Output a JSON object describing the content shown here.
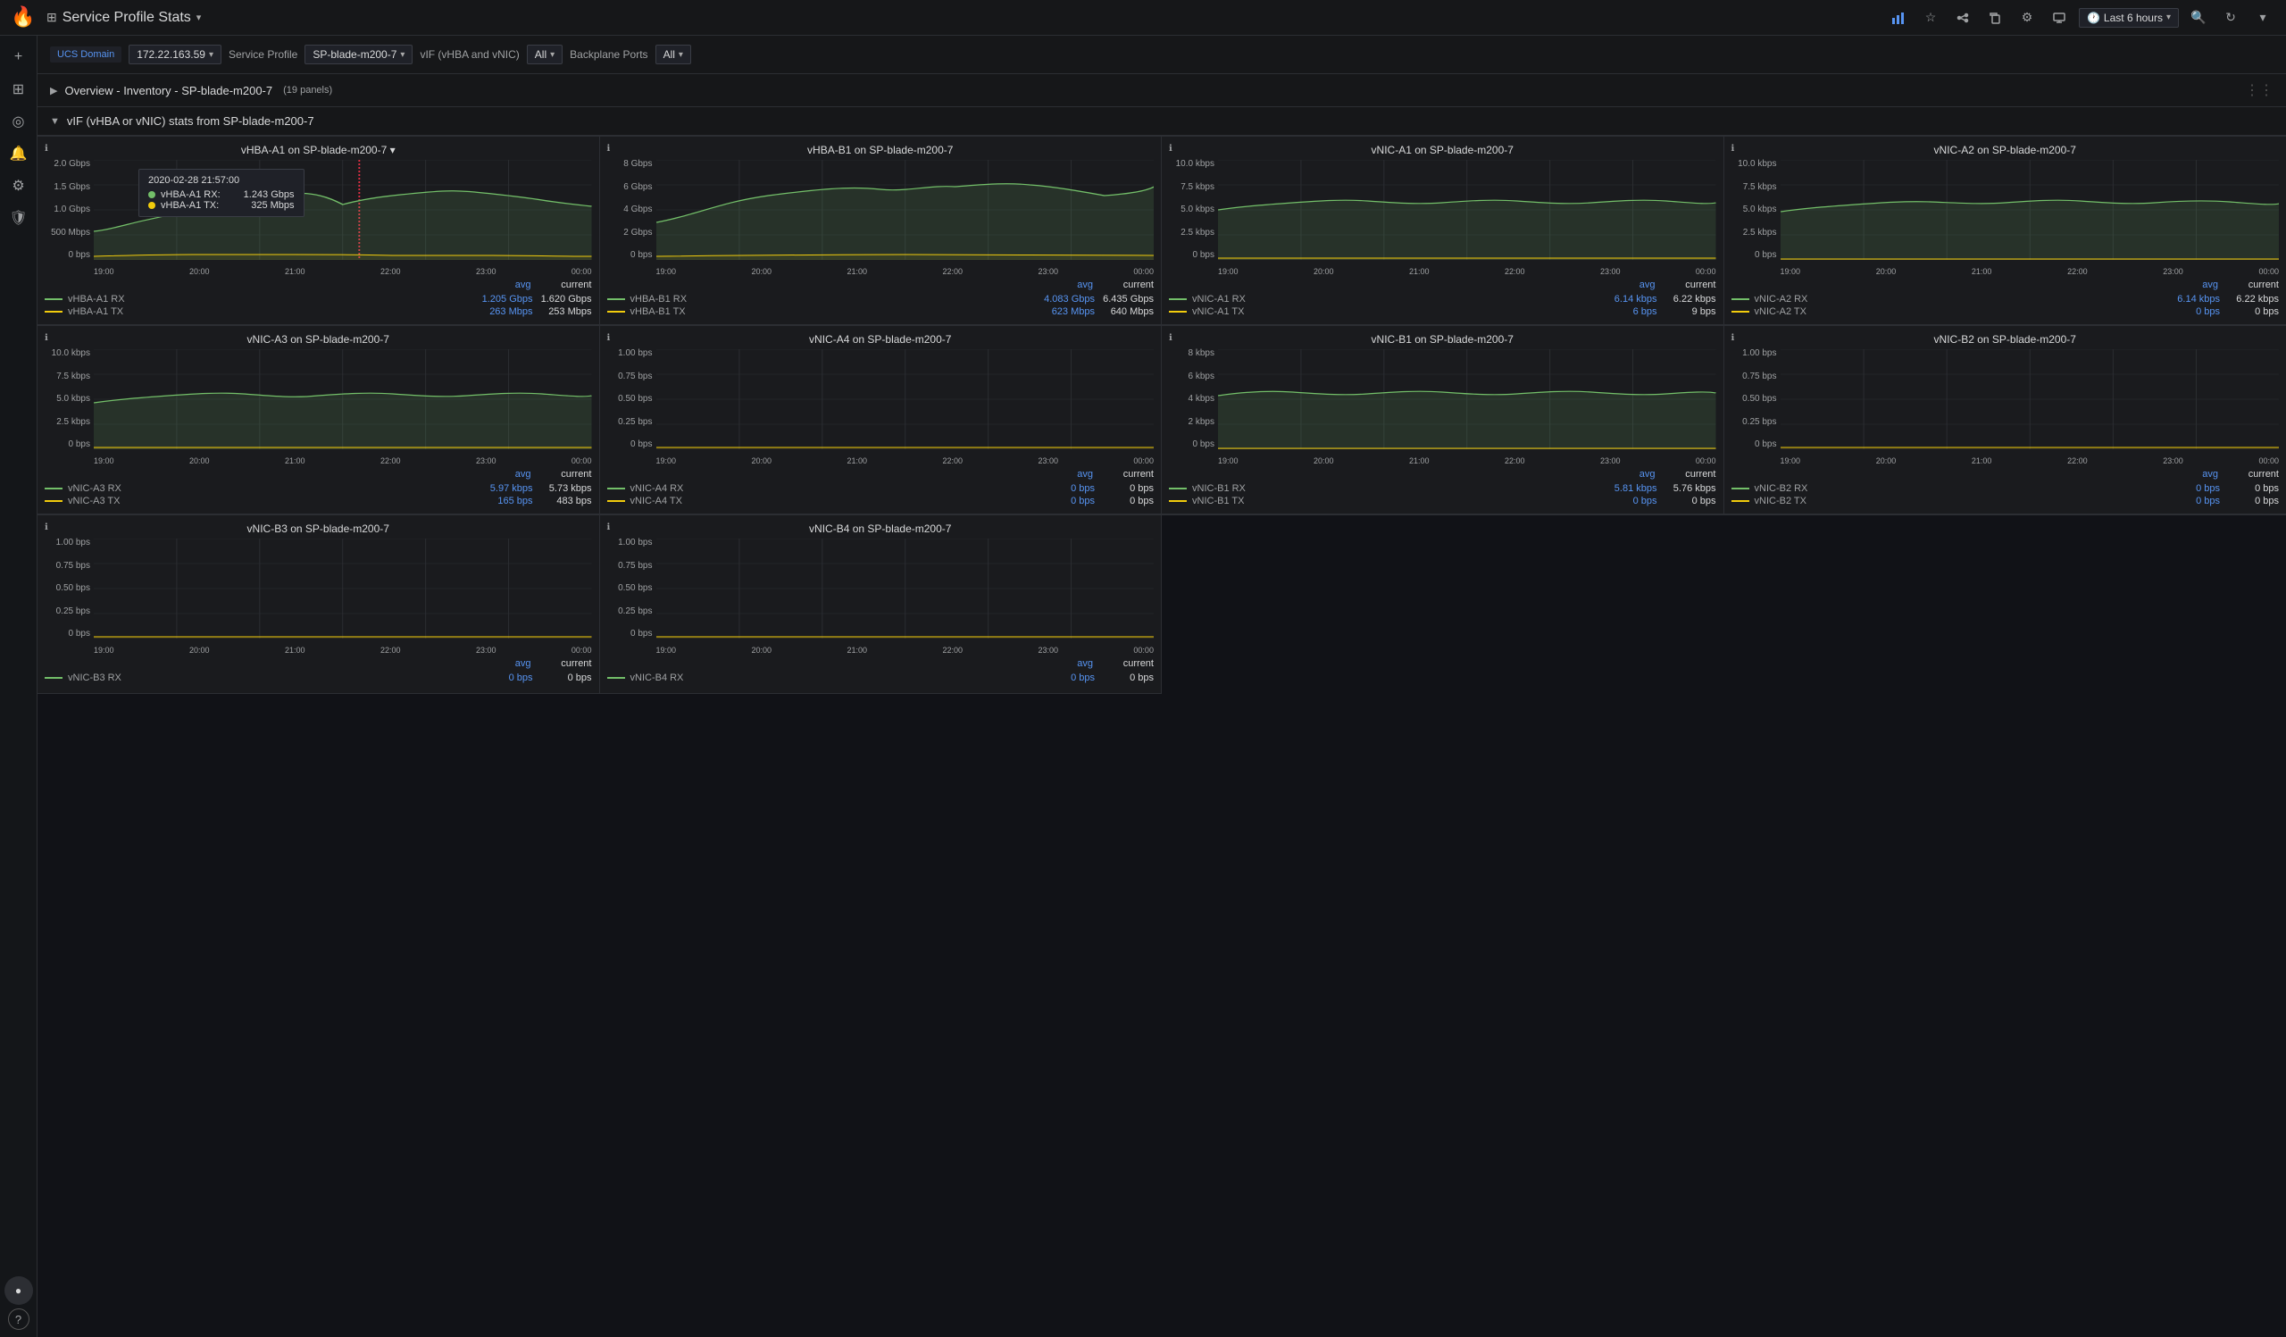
{
  "app": {
    "logo_text": "🔥",
    "title": "Service Profile Stats",
    "title_icon": "⊞"
  },
  "topbar": {
    "icons": [
      "bar-chart",
      "star",
      "share",
      "copy",
      "gear",
      "monitor"
    ],
    "time_range": "Last 6 hours",
    "search_icon": "search",
    "refresh_icon": "refresh",
    "chevron": "▾"
  },
  "sidebar": {
    "items": [
      {
        "icon": "+",
        "name": "add"
      },
      {
        "icon": "⊞",
        "name": "dashboard"
      },
      {
        "icon": "◎",
        "name": "explore"
      },
      {
        "icon": "🔔",
        "name": "alerts"
      },
      {
        "icon": "⚙",
        "name": "settings"
      },
      {
        "icon": "🛡",
        "name": "admin"
      }
    ],
    "bottom": [
      {
        "icon": "●",
        "name": "user"
      },
      {
        "icon": "?",
        "name": "help"
      }
    ]
  },
  "filter_bar": {
    "ucs_domain_label": "UCS Domain",
    "ucs_domain_value": "172.22.163.59",
    "service_profile_label": "Service Profile",
    "service_profile_value": "SP-blade-m200-7",
    "vif_label": "vIF (vHBA and vNIC)",
    "vif_value": "All",
    "backplane_label": "Backplane Ports",
    "backplane_value": "All"
  },
  "sections": [
    {
      "id": "overview",
      "title": "Overview - Inventory - SP-blade-m200-7",
      "panel_count": "19 panels",
      "expanded": false
    },
    {
      "id": "vif_stats",
      "title": "vIF (vHBA or vNIC) stats from SP-blade-m200-7",
      "expanded": true
    }
  ],
  "charts": [
    {
      "id": "vhba-a1",
      "title": "vHBA-A1 on SP-blade-m200-7",
      "y_labels": [
        "2.0 Gbps",
        "1.5 Gbps",
        "1.0 Gbps",
        "500 Mbps",
        "0 bps"
      ],
      "x_labels": [
        "19:00",
        "20:00",
        "21:00",
        "22:00",
        "23:00",
        "00:00"
      ],
      "has_tooltip": true,
      "tooltip": {
        "time": "2020-02-28 21:57:00",
        "rows": [
          {
            "label": "vHBA-A1 RX:",
            "value": "1.243 Gbps",
            "color": "green"
          },
          {
            "label": "vHBA-A1 TX:",
            "value": "325 Mbps",
            "color": "yellow"
          }
        ]
      },
      "legend": [
        {
          "label": "vHBA-A1 RX",
          "avg": "1.205 Gbps",
          "current": "1.620 Gbps",
          "color": "green"
        },
        {
          "label": "vHBA-A1 TX",
          "avg": "263 Mbps",
          "current": "253 Mbps",
          "color": "yellow"
        }
      ]
    },
    {
      "id": "vhba-b1",
      "title": "vHBA-B1 on SP-blade-m200-7",
      "y_labels": [
        "8 Gbps",
        "6 Gbps",
        "4 Gbps",
        "2 Gbps",
        "0 bps"
      ],
      "x_labels": [
        "19:00",
        "20:00",
        "21:00",
        "22:00",
        "23:00",
        "00:00"
      ],
      "has_tooltip": false,
      "legend": [
        {
          "label": "vHBA-B1 RX",
          "avg": "4.083 Gbps",
          "current": "6.435 Gbps",
          "color": "green"
        },
        {
          "label": "vHBA-B1 TX",
          "avg": "623 Mbps",
          "current": "640 Mbps",
          "color": "yellow"
        }
      ]
    },
    {
      "id": "vnic-a1",
      "title": "vNIC-A1 on SP-blade-m200-7",
      "y_labels": [
        "10.0 kbps",
        "7.5 kbps",
        "5.0 kbps",
        "2.5 kbps",
        "0 bps"
      ],
      "x_labels": [
        "19:00",
        "20:00",
        "21:00",
        "22:00",
        "23:00",
        "00:00"
      ],
      "has_tooltip": false,
      "legend": [
        {
          "label": "vNIC-A1 RX",
          "avg": "6.14 kbps",
          "current": "6.22 kbps",
          "color": "green"
        },
        {
          "label": "vNIC-A1 TX",
          "avg": "6 bps",
          "current": "9 bps",
          "color": "yellow"
        }
      ]
    },
    {
      "id": "vnic-a2",
      "title": "vNIC-A2 on SP-blade-m200-7",
      "y_labels": [
        "10.0 kbps",
        "7.5 kbps",
        "5.0 kbps",
        "2.5 kbps",
        "0 bps"
      ],
      "x_labels": [
        "19:00",
        "20:00",
        "21:00",
        "22:00",
        "23:00",
        "00:00"
      ],
      "has_tooltip": false,
      "legend": [
        {
          "label": "vNIC-A2 RX",
          "avg": "6.14 kbps",
          "current": "6.22 kbps",
          "color": "green"
        },
        {
          "label": "vNIC-A2 TX",
          "avg": "0 bps",
          "current": "0 bps",
          "color": "yellow"
        }
      ]
    },
    {
      "id": "vnic-a3",
      "title": "vNIC-A3 on SP-blade-m200-7",
      "y_labels": [
        "10.0 kbps",
        "7.5 kbps",
        "5.0 kbps",
        "2.5 kbps",
        "0 bps"
      ],
      "x_labels": [
        "19:00",
        "20:00",
        "21:00",
        "22:00",
        "23:00",
        "00:00"
      ],
      "has_tooltip": false,
      "legend": [
        {
          "label": "vNIC-A3 RX",
          "avg": "5.97 kbps",
          "current": "5.73 kbps",
          "color": "green"
        },
        {
          "label": "vNIC-A3 TX",
          "avg": "165 bps",
          "current": "483 bps",
          "color": "yellow"
        }
      ]
    },
    {
      "id": "vnic-a4",
      "title": "vNIC-A4 on SP-blade-m200-7",
      "y_labels": [
        "1.00 bps",
        "0.75 bps",
        "0.50 bps",
        "0.25 bps",
        "0 bps"
      ],
      "x_labels": [
        "19:00",
        "20:00",
        "21:00",
        "22:00",
        "23:00",
        "00:00"
      ],
      "has_tooltip": false,
      "legend": [
        {
          "label": "vNIC-A4 RX",
          "avg": "0 bps",
          "current": "0 bps",
          "color": "green"
        },
        {
          "label": "vNIC-A4 TX",
          "avg": "0 bps",
          "current": "0 bps",
          "color": "yellow"
        }
      ]
    },
    {
      "id": "vnic-b1",
      "title": "vNIC-B1 on SP-blade-m200-7",
      "y_labels": [
        "8 kbps",
        "6 kbps",
        "4 kbps",
        "2 kbps",
        "0 bps"
      ],
      "x_labels": [
        "19:00",
        "20:00",
        "21:00",
        "22:00",
        "23:00",
        "00:00"
      ],
      "has_tooltip": false,
      "legend": [
        {
          "label": "vNIC-B1 RX",
          "avg": "5.81 kbps",
          "current": "5.76 kbps",
          "color": "green"
        },
        {
          "label": "vNIC-B1 TX",
          "avg": "0 bps",
          "current": "0 bps",
          "color": "yellow"
        }
      ]
    },
    {
      "id": "vnic-b2",
      "title": "vNIC-B2 on SP-blade-m200-7",
      "y_labels": [
        "1.00 bps",
        "0.75 bps",
        "0.50 bps",
        "0.25 bps",
        "0 bps"
      ],
      "x_labels": [
        "19:00",
        "20:00",
        "21:00",
        "22:00",
        "23:00",
        "00:00"
      ],
      "has_tooltip": false,
      "legend": [
        {
          "label": "vNIC-B2 RX",
          "avg": "0 bps",
          "current": "0 bps",
          "color": "green"
        },
        {
          "label": "vNIC-B2 TX",
          "avg": "0 bps",
          "current": "0 bps",
          "color": "yellow"
        }
      ]
    },
    {
      "id": "vnic-b3",
      "title": "vNIC-B3 on SP-blade-m200-7",
      "y_labels": [
        "1.00 bps",
        "0.75 bps",
        "0.50 bps",
        "0.25 bps",
        "0 bps"
      ],
      "x_labels": [
        "19:00",
        "20:00",
        "21:00",
        "22:00",
        "23:00",
        "00:00"
      ],
      "has_tooltip": false,
      "legend": [
        {
          "label": "vNIC-B3 RX",
          "avg": "0 bps",
          "current": "0 bps",
          "color": "green"
        }
      ]
    },
    {
      "id": "vnic-b4",
      "title": "vNIC-B4 on SP-blade-m200-7",
      "y_labels": [
        "1.00 bps",
        "0.75 bps",
        "0.50 bps",
        "0.25 bps",
        "0 bps"
      ],
      "x_labels": [
        "19:00",
        "20:00",
        "21:00",
        "22:00",
        "23:00",
        "00:00"
      ],
      "has_tooltip": false,
      "legend": [
        {
          "label": "vNIC-B4 RX",
          "avg": "0 bps",
          "current": "0 bps",
          "color": "green"
        }
      ]
    }
  ]
}
